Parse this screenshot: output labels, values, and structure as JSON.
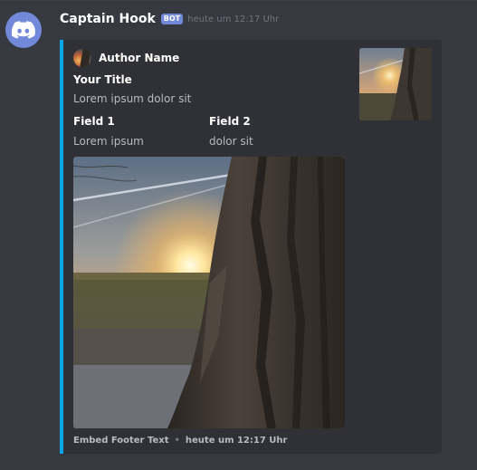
{
  "message": {
    "username": "Captain Hook",
    "bot_tag": "BOT",
    "timestamp": "heute um 12:17 Uhr"
  },
  "embed": {
    "accent_color": "#0aa6e8",
    "author_name": "Author Name",
    "title": "Your Title",
    "description": "Lorem ipsum dolor sit",
    "fields": [
      {
        "name": "Field 1",
        "value": "Lorem ipsum"
      },
      {
        "name": "Field 2",
        "value": "dolor sit"
      }
    ],
    "footer_text": "Embed Footer Text",
    "footer_separator": "•",
    "footer_timestamp": "heute um 12:17 Uhr"
  },
  "icons": {
    "avatar": "discord-logo-icon"
  }
}
